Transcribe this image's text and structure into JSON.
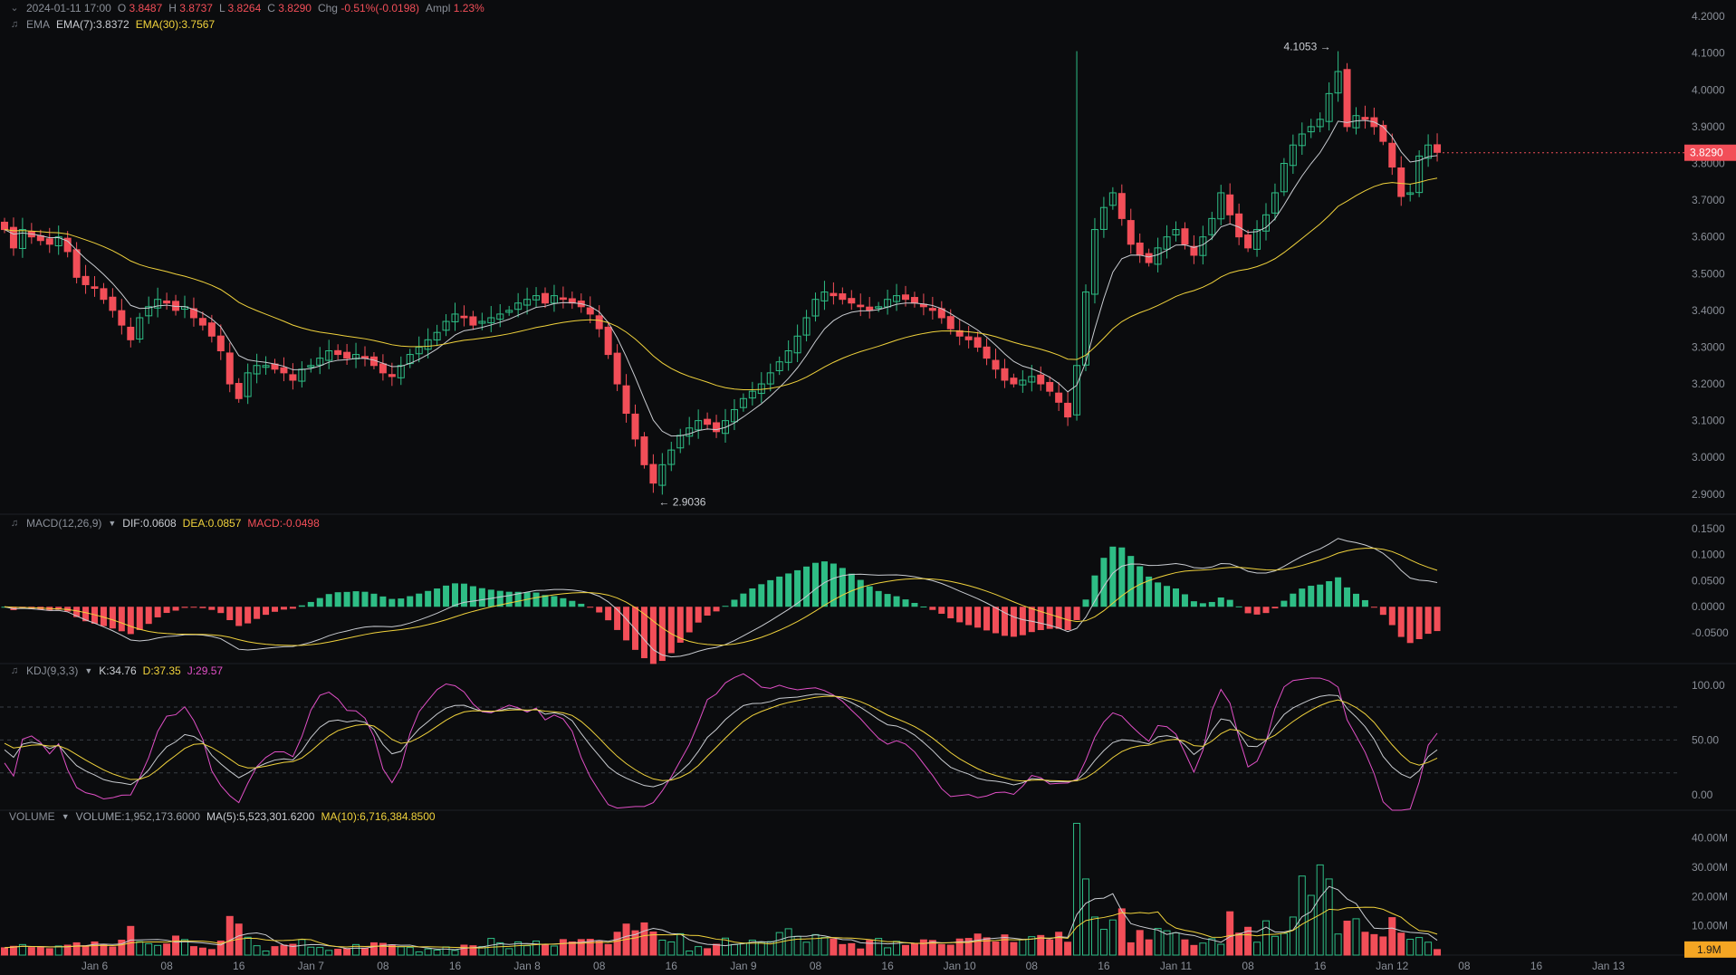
{
  "header": {
    "date": "2024-01-11 17:00",
    "o_label": "O",
    "o_value": "3.8487",
    "h_label": "H",
    "h_value": "3.8737",
    "l_label": "L",
    "l_value": "3.8264",
    "c_label": "C",
    "c_value": "3.8290",
    "chg_label": "Chg",
    "chg_value": "-0.51%(-0.0198)",
    "ampl_label": "Ampl",
    "ampl_value": "1.23%"
  },
  "ema_legend": {
    "name": "EMA",
    "ema7": "EMA(7):3.8372",
    "ema30": "EMA(30):3.7567"
  },
  "macd_legend": {
    "name": "MACD(12,26,9)",
    "dif": "DIF:0.0608",
    "dea": "DEA:0.0857",
    "macd": "MACD:-0.0498"
  },
  "kdj_legend": {
    "name": "KDJ(9,3,3)",
    "k": "K:34.76",
    "d": "D:37.35",
    "j": "J:29.57"
  },
  "vol_legend": {
    "name": "VOLUME",
    "volume": "VOLUME:1,952,173.6000",
    "ma5": "MA(5):5,523,301.6200",
    "ma10": "MA(10):6,716,384.8500"
  },
  "colors": {
    "up": "#2ebd85",
    "down": "#f24e58",
    "ema7": "#c9ccd1",
    "ema30": "#f0d23c",
    "kdj_j": "#e04fc6",
    "grid": "#1e2126",
    "background": "#0b0c0e"
  },
  "chart_data": {
    "type": "candlestick",
    "price_axis": {
      "ticks": [
        "4.2000",
        "4.1000",
        "4.0000",
        "3.9000",
        "3.8000",
        "3.7000",
        "3.6000",
        "3.5000",
        "3.4000",
        "3.3000",
        "3.2000",
        "3.1000",
        "3.0000",
        "2.9000"
      ],
      "range": [
        2.87,
        4.22
      ],
      "last_price": "3.8290"
    },
    "annotations": {
      "high": "4.1053",
      "low": "2.9036"
    },
    "x_axis_labels": [
      "Jan 6",
      "08",
      "16",
      "Jan 7",
      "08",
      "16",
      "Jan 8",
      "08",
      "16",
      "Jan 9",
      "08",
      "16",
      "Jan 10",
      "08",
      "16",
      "Jan 11",
      "08",
      "16",
      "Jan 12",
      "08",
      "16",
      "Jan 13"
    ],
    "interval": "2h",
    "closes": [
      3.62,
      3.57,
      3.62,
      3.6,
      3.59,
      3.58,
      3.6,
      3.56,
      3.49,
      3.47,
      3.46,
      3.43,
      3.4,
      3.36,
      3.32,
      3.38,
      3.41,
      3.43,
      3.42,
      3.4,
      3.41,
      3.38,
      3.36,
      3.33,
      3.29,
      3.2,
      3.16,
      3.23,
      3.25,
      3.25,
      3.24,
      3.23,
      3.21,
      3.24,
      3.25,
      3.27,
      3.29,
      3.28,
      3.27,
      3.28,
      3.27,
      3.25,
      3.23,
      3.22,
      3.25,
      3.28,
      3.3,
      3.32,
      3.34,
      3.37,
      3.39,
      3.38,
      3.36,
      3.37,
      3.38,
      3.39,
      3.4,
      3.42,
      3.43,
      3.44,
      3.42,
      3.44,
      3.43,
      3.42,
      3.41,
      3.39,
      3.35,
      3.28,
      3.2,
      3.12,
      3.05,
      2.98,
      2.93,
      2.98,
      3.02,
      3.06,
      3.08,
      3.1,
      3.09,
      3.07,
      3.1,
      3.13,
      3.16,
      3.18,
      3.2,
      3.23,
      3.26,
      3.29,
      3.33,
      3.38,
      3.43,
      3.45,
      3.44,
      3.43,
      3.42,
      3.41,
      3.4,
      3.41,
      3.43,
      3.44,
      3.43,
      3.42,
      3.41,
      3.4,
      3.38,
      3.35,
      3.33,
      3.32,
      3.3,
      3.27,
      3.24,
      3.21,
      3.2,
      3.21,
      3.22,
      3.2,
      3.18,
      3.15,
      3.11,
      3.25,
      3.45,
      3.62,
      3.68,
      3.72,
      3.65,
      3.58,
      3.55,
      3.53,
      3.57,
      3.6,
      3.62,
      3.58,
      3.55,
      3.6,
      3.65,
      3.72,
      3.66,
      3.6,
      3.57,
      3.62,
      3.66,
      3.72,
      3.8,
      3.85,
      3.88,
      3.9,
      3.92,
      3.99,
      4.05,
      3.9,
      3.93,
      3.92,
      3.9,
      3.86,
      3.79,
      3.71,
      3.72,
      3.82,
      3.85,
      3.83
    ],
    "ema7_last": 3.8372,
    "ema30_last": 3.7567,
    "macd_axis": {
      "ticks": [
        "0.1500",
        "0.1000",
        "0.0500",
        "0.0000",
        "-0.0500"
      ],
      "range": [
        -0.095,
        0.16
      ]
    },
    "kdj_axis": {
      "ticks": [
        "100.00",
        "50.00",
        "0.00"
      ],
      "range": [
        -14,
        118
      ],
      "levels": [
        80,
        50,
        20
      ]
    },
    "volume_axis": {
      "ticks": [
        "40.00M",
        "30.00M",
        "20.00M",
        "10.00M"
      ],
      "range": [
        0,
        47
      ],
      "unit": "M",
      "last_volume": "1.9M"
    },
    "volumes": [
      2.5,
      3.0,
      3.6,
      2.6,
      2.8,
      2.2,
      3.1,
      3.4,
      4.2,
      3.2,
      4.5,
      3.5,
      2.8,
      5.1,
      9.8,
      4.6,
      3.9,
      3.3,
      3.8,
      6.5,
      5.3,
      2.9,
      2.4,
      1.9,
      4.8,
      13.2,
      10.6,
      6.1,
      3.2,
      1.4,
      2.9,
      3.4,
      3.7,
      5.3,
      2.7,
      2.6,
      1.6,
      2.0,
      2.2,
      3.6,
      2.4,
      4.2,
      4.0,
      3.5,
      2.8,
      2.6,
      1.1,
      2.1,
      1.7,
      2.8,
      1.6,
      3.4,
      3.2,
      2.9,
      5.7,
      4.2,
      2.2,
      4.5,
      3.2,
      4.8,
      3.4,
      3.1,
      5.3,
      4.5,
      5.3,
      5.4,
      4.7,
      3.6,
      7.8,
      10.6,
      8.3,
      11.0,
      7.9,
      5.1,
      4.5,
      7.3,
      1.4,
      2.9,
      2.2,
      3.7,
      5.8,
      3.6,
      4.1,
      5.1,
      4.4,
      4.6,
      7.7,
      9.0,
      6.4,
      4.4,
      7.0,
      6.0,
      5.5,
      3.6,
      3.9,
      2.1,
      5.0,
      5.7,
      2.5,
      4.7,
      3.3,
      4.0,
      5.2,
      5.0,
      3.6,
      3.4,
      5.5,
      5.7,
      7.2,
      5.9,
      4.5,
      6.9,
      4.3,
      5.3,
      6.3,
      6.7,
      5.2,
      7.8,
      4.4,
      45.0,
      26.0,
      13.0,
      8.8,
      12.0,
      15.8,
      4.2,
      8.4,
      5.2,
      9.1,
      8.3,
      7.6,
      5.2,
      3.3,
      4.1,
      5.6,
      3.7,
      14.8,
      7.5,
      9.5,
      4.4,
      11.7,
      6.4,
      7.4,
      13.0,
      27.0,
      20.4,
      30.8,
      26.0,
      7.2,
      11.6,
      12.4,
      7.8,
      7.0,
      6.2,
      12.8,
      7.5,
      5.4,
      6.0,
      4.4,
      1.9
    ]
  }
}
